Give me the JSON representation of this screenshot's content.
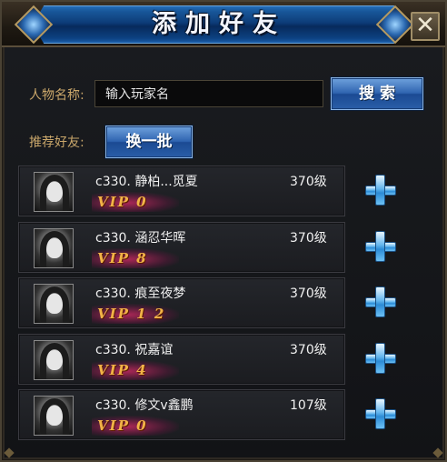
{
  "window": {
    "title": "添加好友",
    "close_glyph": "✕"
  },
  "search": {
    "name_label": "人物名称:",
    "input_value": "输入玩家名",
    "search_button": "搜 索"
  },
  "recommend": {
    "label": "推荐好友:",
    "refresh_button": "换一批"
  },
  "friends": [
    {
      "name": "c330. 静柏...觅夏",
      "level": "370级",
      "vip": "VIP 0"
    },
    {
      "name": "c330. 涵忍华晖",
      "level": "370级",
      "vip": "VIP 8"
    },
    {
      "name": "c330. 痕至夜梦",
      "level": "370级",
      "vip": "VIP 1 2"
    },
    {
      "name": "c330. 祝嘉谊",
      "level": "370级",
      "vip": "VIP 4"
    },
    {
      "name": "c330. 修文v鑫鹏",
      "level": "107级",
      "vip": "VIP 0"
    }
  ],
  "colors": {
    "label_gold": "#c9a66a",
    "vip_gold": "#f2b347",
    "button_blue": "#2f64b0",
    "title_blue": "#0d3c78"
  },
  "icons": {
    "close": "close-icon",
    "add": "plus-icon",
    "avatar": "avatar-portrait"
  }
}
